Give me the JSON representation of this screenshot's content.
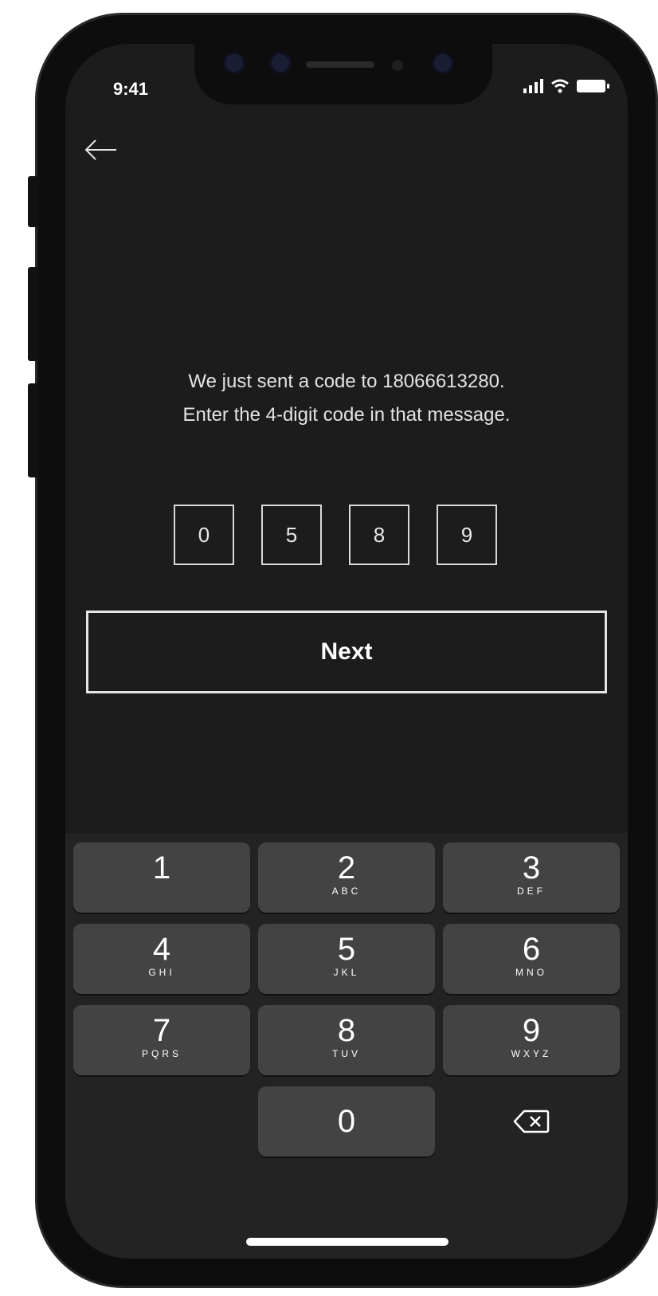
{
  "status": {
    "time": "9:41"
  },
  "header": {
    "back_icon": "arrow-left-icon"
  },
  "message": {
    "line1": "We just sent a code to 18066613280.",
    "line2": "Enter the 4-digit code in that message."
  },
  "code": {
    "digits": [
      "0",
      "5",
      "8",
      "9"
    ]
  },
  "next_button": {
    "label": "Next"
  },
  "keypad": {
    "keys": [
      {
        "num": "1",
        "letters": ""
      },
      {
        "num": "2",
        "letters": "ABC"
      },
      {
        "num": "3",
        "letters": "DEF"
      },
      {
        "num": "4",
        "letters": "GHI"
      },
      {
        "num": "5",
        "letters": "JKL"
      },
      {
        "num": "6",
        "letters": "MNO"
      },
      {
        "num": "7",
        "letters": "PQRS"
      },
      {
        "num": "8",
        "letters": "TUV"
      },
      {
        "num": "9",
        "letters": "WXYZ"
      },
      {
        "num": "0",
        "letters": ""
      }
    ],
    "delete_icon": "backspace-icon"
  },
  "colors": {
    "screen_bg": "#1c1c1c",
    "keypad_bg": "#232323",
    "key_bg": "#434343",
    "text": "#ffffff"
  }
}
